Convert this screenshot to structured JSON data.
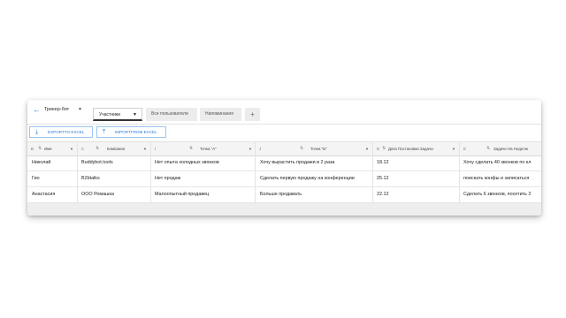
{
  "topbar": {
    "title": "Трекер-бот"
  },
  "tabs": [
    {
      "label": "Участники"
    },
    {
      "label": "Все пользователи"
    },
    {
      "label": "Напоминания"
    },
    {
      "label": "+"
    }
  ],
  "toolbar": {
    "export_label": "EXPORTTO EXCEL",
    "import_label": "IMPORTFROM EXCEL"
  },
  "columns": [
    {
      "letter": "B",
      "name": "Имя"
    },
    {
      "letter": "C",
      "name": "Компания"
    },
    {
      "letter": "I",
      "name": "Точка \"А\""
    },
    {
      "letter": "J",
      "name": "Точка \"Б\""
    },
    {
      "letter": "D",
      "name": "Дата Постановки Задачи"
    },
    {
      "letter": "E",
      "name": "Задачи На Неделю"
    }
  ],
  "rows": [
    [
      "Николай",
      "Buddybot.tools",
      "Нет опыта холодных звонков",
      "Хочу вырастить продажи в 2 раза",
      "18.12",
      "Хочу сделать 40 звонков по кл"
    ],
    [
      "Гио",
      "B2btalks",
      "Нет продаж",
      "Сделать первую продажу на конференции",
      "25.12",
      "поискать конфы и записаться"
    ],
    [
      "Анастасия",
      "ООО Ромашка",
      "Малоопытный продавец",
      "Больше продавать",
      "22.12",
      "Сделать 6 звонков, посетить 2"
    ]
  ]
}
